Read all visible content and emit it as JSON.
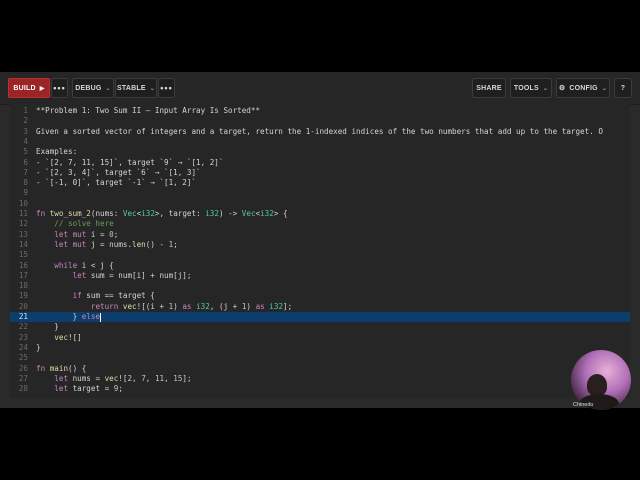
{
  "toolbar": {
    "build_label": "BUILD",
    "build_arrow": "▶",
    "more_label": "•••",
    "debug_label": "DEBUG",
    "stable_label": "STABLE",
    "more2_label": "•••",
    "share_label": "SHARE",
    "tools_label": "TOOLS",
    "config_label": "CONFIG",
    "config_icon": "⚙",
    "help_label": "?",
    "chevron": "⌄"
  },
  "editor": {
    "active_line": 21,
    "lines": [
      {
        "n": "1",
        "t": "**Problem 1: Two Sum II — Input Array Is Sorted**"
      },
      {
        "n": "2",
        "t": ""
      },
      {
        "n": "3",
        "t": "Given a sorted vector of integers and a target, return the 1-indexed indices of the two numbers that add up to the target. O"
      },
      {
        "n": "4",
        "t": ""
      },
      {
        "n": "5",
        "t": "Examples:"
      },
      {
        "n": "6",
        "t": "- `[2, 7, 11, 15]`, target `9` → `[1, 2]`"
      },
      {
        "n": "7",
        "t": "- `[2, 3, 4]`, target `6` → `[1, 3]`"
      },
      {
        "n": "8",
        "t": "- `[-1, 0]`, target `-1` → `[1, 2]`"
      },
      {
        "n": "9",
        "t": ""
      },
      {
        "n": "10",
        "t": ""
      },
      {
        "n": "11",
        "t": "fn two_sum_2(nums: Vec<i32>, target: i32) -> Vec<i32> {"
      },
      {
        "n": "12",
        "t": "    // solve here"
      },
      {
        "n": "13",
        "t": "    let mut i = 0;"
      },
      {
        "n": "14",
        "t": "    let mut j = nums.len() - 1;"
      },
      {
        "n": "15",
        "t": ""
      },
      {
        "n": "16",
        "t": "    while i < j {"
      },
      {
        "n": "17",
        "t": "        let sum = num[i] + num[j];"
      },
      {
        "n": "18",
        "t": ""
      },
      {
        "n": "19",
        "t": "        if sum == target {"
      },
      {
        "n": "20",
        "t": "            return vec![(i + 1) as i32, (j + 1) as i32];"
      },
      {
        "n": "21",
        "t": "        } else"
      },
      {
        "n": "22",
        "t": "    }"
      },
      {
        "n": "23",
        "t": "    vec![]"
      },
      {
        "n": "24",
        "t": "}"
      },
      {
        "n": "25",
        "t": ""
      },
      {
        "n": "26",
        "t": "fn main() {"
      },
      {
        "n": "27",
        "t": "    let nums = vec![2, 7, 11, 15];"
      },
      {
        "n": "28",
        "t": "    let target = 9;"
      }
    ]
  },
  "webcam": {
    "label": "Chinedu"
  }
}
